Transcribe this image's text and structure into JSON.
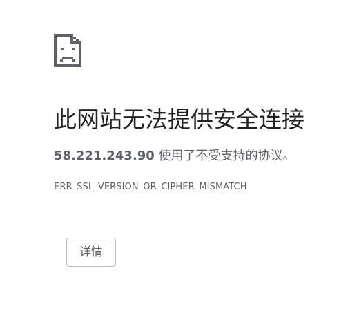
{
  "error": {
    "icon": "sad-document-icon",
    "heading": "此网站无法提供安全连接",
    "host": "58.221.243.90",
    "message_suffix": " 使用了不受支持的协议。",
    "error_code": "ERR_SSL_VERSION_OR_CIPHER_MISMATCH",
    "details_label": "详情"
  },
  "colors": {
    "heading": "#202124",
    "body_text": "#5f6368",
    "icon": "#5f6368",
    "button_border": "#b8bcc2",
    "background": "#ffffff"
  }
}
